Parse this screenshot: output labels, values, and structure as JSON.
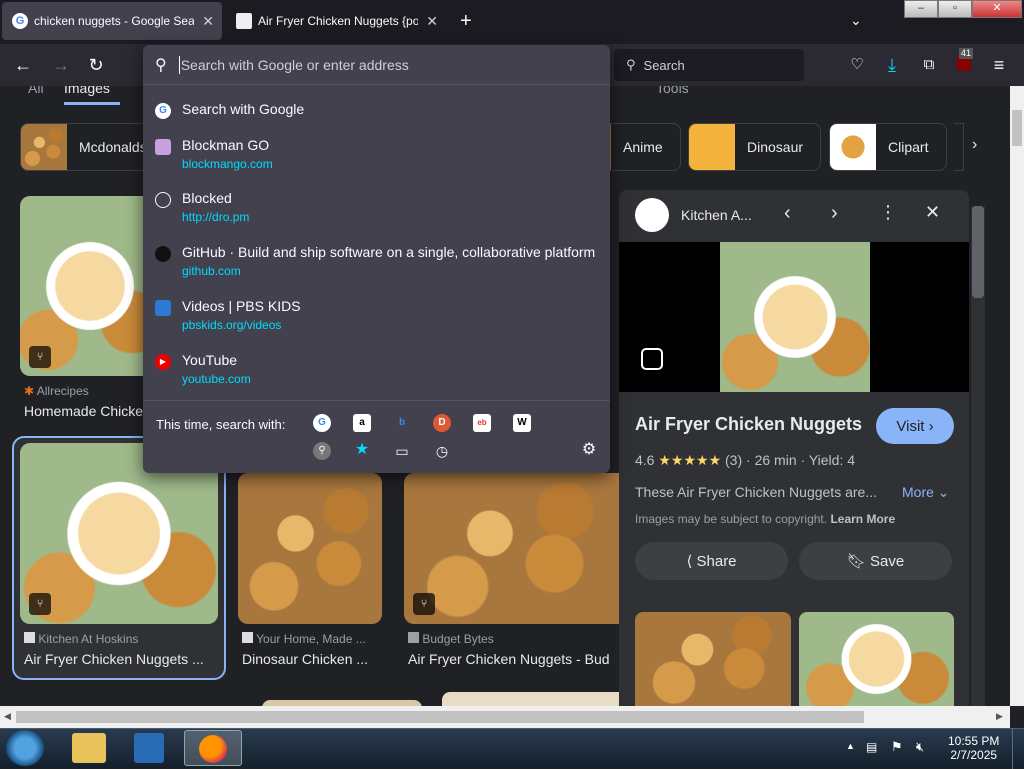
{
  "tabs": [
    {
      "title": "chicken nuggets - Google Search",
      "active": true
    },
    {
      "title": "Air Fryer Chicken Nuggets {popular",
      "active": false
    }
  ],
  "toolbar": {
    "search_placeholder": "Search",
    "badge_count": "41"
  },
  "url_bar": {
    "placeholder": "Search with Google or enter address"
  },
  "suggestions": [
    {
      "title": "Search with Google",
      "url": "",
      "icon": "google-icon"
    },
    {
      "title": "Blockman GO",
      "url": "blockmango.com",
      "icon": "blockman-icon"
    },
    {
      "title": "Blocked",
      "url": "http://dro.pm",
      "icon": "globe-icon"
    },
    {
      "title": "GitHub · Build and ship software on a single, collaborative platform",
      "url": "github.com",
      "icon": "github-icon"
    },
    {
      "title": "Videos | PBS KIDS",
      "url": "pbskids.org/videos",
      "icon": "pbs-icon"
    },
    {
      "title": "YouTube",
      "url": "youtube.com",
      "icon": "youtube-icon"
    }
  ],
  "search_with": {
    "label": "This time, search with:"
  },
  "google": {
    "tabs": {
      "all": "All",
      "images": "Images",
      "tools": "Tools"
    },
    "chips": [
      {
        "label": "Mcdonalds"
      },
      {
        "label": "Anime"
      },
      {
        "label": "Dinosaur"
      },
      {
        "label": "Clipart"
      }
    ],
    "results": [
      {
        "source": "Allrecipes",
        "caption": "Homemade Chicken Nuggets"
      },
      {
        "source": "Kitchen At Hoskins",
        "caption": "Air Fryer Chicken Nuggets ..."
      },
      {
        "source": "Your Home, Made ...",
        "caption": "Dinosaur Chicken ..."
      },
      {
        "source": "Budget Bytes",
        "caption": "Air Fryer Chicken Nuggets - Bud"
      }
    ],
    "panel": {
      "site": "Kitchen A...",
      "title": "Air Fryer Chicken Nuggets",
      "visit": "Visit",
      "rating": "4.6",
      "stars": "★★★★★",
      "reviews": "(3)",
      "time": "26 min",
      "yield": "Yield: 4",
      "desc": "These Air Fryer Chicken Nuggets are...",
      "more": "More",
      "copyright": "Images may be subject to copyright.",
      "learn_more": "Learn More",
      "share": "Share",
      "save": "Save"
    }
  },
  "taskbar": {
    "time": "10:55 PM",
    "date": "2/7/2025"
  }
}
